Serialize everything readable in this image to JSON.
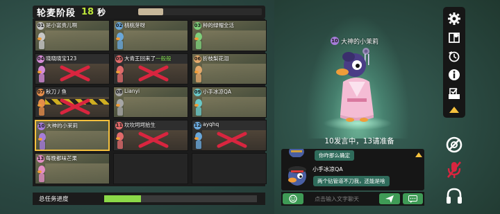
{
  "header": {
    "phase_title": "轮麦阶段",
    "seconds": "18",
    "unit": "秒",
    "time_remaining": 0.2
  },
  "players": [
    {
      "num": "01",
      "name": "是小富贵儿啊",
      "state": "alive",
      "color": "#c7c7c7"
    },
    {
      "num": "02",
      "name": "桃桃芽呀",
      "state": "alive",
      "color": "#6aa7d9"
    },
    {
      "num": "03",
      "name": "种的绿帽全活",
      "state": "alive",
      "color": "#7fcf7a"
    },
    {
      "num": "04",
      "name": "晓晓晓宝123",
      "state": "dead",
      "color": "#d58bd6"
    },
    {
      "num": "05",
      "name": "大青王回来了",
      "name_suffix": "一般般",
      "state": "dead",
      "color": "#e06a6a"
    },
    {
      "num": "06",
      "name": "折枝梨花泪",
      "state": "alive",
      "color": "#e2a86b"
    },
    {
      "num": "07",
      "name": "秋刀丿鱼",
      "state": "dead",
      "color": "#e58d4a"
    },
    {
      "num": "08",
      "name": "Lianyi",
      "state": "alive",
      "color": "#a6a6a6"
    },
    {
      "num": "09",
      "name": "小手冰凉QA",
      "state": "alive",
      "color": "#6ac8c8"
    },
    {
      "num": "10",
      "name": "大神的小茉莉",
      "state": "speaking",
      "color": "#a57cd9"
    },
    {
      "num": "11",
      "name": "坎坎坷坷拾生",
      "state": "dead",
      "color": "#e06a6a"
    },
    {
      "num": "12",
      "name": "ayqhq",
      "state": "dead",
      "color": "#6aa7d9"
    },
    {
      "num": "13",
      "name": "每晚都味芒果",
      "state": "alive",
      "color": "#e28ec3"
    }
  ],
  "progress": {
    "label": "总任务进度",
    "value": 0.24
  },
  "speaker": {
    "num": "10",
    "name": "大神的小茉莉"
  },
  "status_line": "10发言中，13请准备",
  "chat": {
    "messages": [
      {
        "text": "你咋那么确定"
      },
      {
        "name": "小手冰凉QA",
        "text": "两个钻管道不刀我，还能是啥"
      }
    ]
  },
  "input": {
    "placeholder": "点击输入文字聊天"
  },
  "toolbar": {
    "icons": [
      "gear-icon",
      "map-icon",
      "history-icon",
      "info-icon",
      "vote-icon",
      "collapse-arrow-icon"
    ]
  },
  "side_buttons": [
    "speaker-mute-icon",
    "mic-mute-icon",
    "headphones-icon"
  ],
  "colors": {
    "accent_green": "#3f9b56",
    "highlight_yellow": "#f6c13d",
    "x_red": "#d9253f",
    "lime": "#bde63a"
  }
}
